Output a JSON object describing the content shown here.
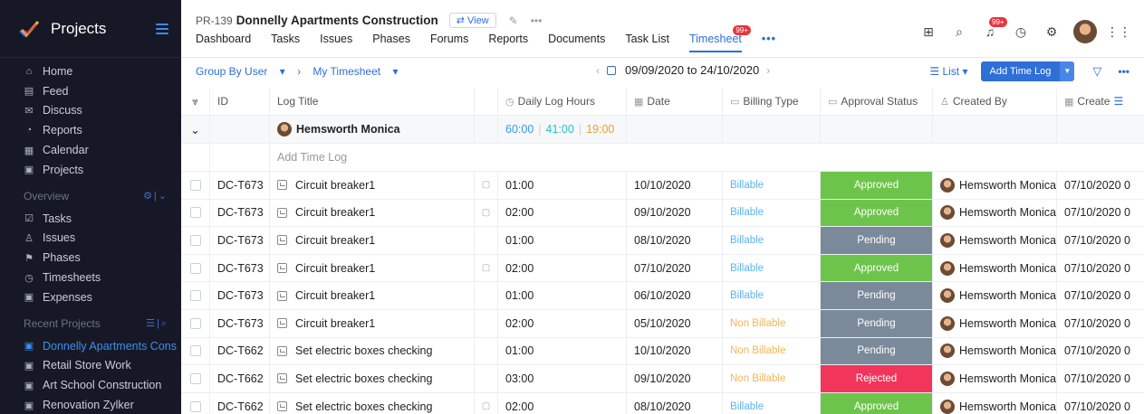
{
  "sidebar": {
    "title": "Projects",
    "nav": [
      {
        "label": "Home",
        "icon": "home-icon",
        "glyph": "⌂"
      },
      {
        "label": "Feed",
        "icon": "feed-icon",
        "glyph": "▤"
      },
      {
        "label": "Discuss",
        "icon": "discuss-icon",
        "glyph": "✉"
      },
      {
        "label": "Reports",
        "icon": "reports-icon",
        "glyph": "◔"
      },
      {
        "label": "Calendar",
        "icon": "calendar-icon",
        "glyph": "▦"
      },
      {
        "label": "Projects",
        "icon": "projects-icon",
        "glyph": "▣"
      }
    ],
    "overview_label": "Overview",
    "overview": [
      {
        "label": "Tasks",
        "icon": "tasks-icon",
        "glyph": "☑"
      },
      {
        "label": "Issues",
        "icon": "issues-icon",
        "glyph": "♙"
      },
      {
        "label": "Phases",
        "icon": "phases-icon",
        "glyph": "⚑"
      },
      {
        "label": "Timesheets",
        "icon": "timesheets-icon",
        "glyph": "◷"
      },
      {
        "label": "Expenses",
        "icon": "expenses-icon",
        "glyph": "▣"
      }
    ],
    "recent_label": "Recent Projects",
    "recent": [
      {
        "label": "Donnelly Apartments Cons",
        "active": true
      },
      {
        "label": "Retail Store Work",
        "active": false
      },
      {
        "label": "Art School Construction",
        "active": false
      },
      {
        "label": "Renovation Zylker",
        "active": false
      }
    ]
  },
  "header": {
    "project_code": "PR-139",
    "project_name": "Donnelly Apartments Construction",
    "view_label": "View",
    "tabs": [
      {
        "label": "Dashboard",
        "active": false
      },
      {
        "label": "Tasks",
        "active": false
      },
      {
        "label": "Issues",
        "active": false
      },
      {
        "label": "Phases",
        "active": false
      },
      {
        "label": "Forums",
        "active": false
      },
      {
        "label": "Reports",
        "active": false
      },
      {
        "label": "Documents",
        "active": false
      },
      {
        "label": "Task List",
        "active": false
      },
      {
        "label": "Timesheet",
        "active": true,
        "badge": "99+"
      }
    ],
    "notification_badge": "99+"
  },
  "toolbar": {
    "group_by": "Group By User",
    "view_name": "My Timesheet",
    "date_range": "09/09/2020 to 24/10/2020",
    "list_label": "List",
    "add_button": "Add Time Log"
  },
  "grid": {
    "columns": {
      "id": "ID",
      "title": "Log Title",
      "hours": "Daily Log Hours",
      "date": "Date",
      "billing": "Billing Type",
      "approval": "Approval Status",
      "created_by": "Created By",
      "created": "Create"
    },
    "group": {
      "name": "Hemsworth Monica",
      "total": "60:00",
      "billable": "41:00",
      "non_billable": "19:00"
    },
    "add_row_label": "Add Time Log",
    "rows": [
      {
        "id": "DC-T673",
        "title": "Circuit breaker1",
        "note": true,
        "hours": "01:00",
        "date": "10/10/2020",
        "billing": "Billable",
        "status": "Approved",
        "by": "Hemsworth Monica",
        "created": "07/10/2020 0"
      },
      {
        "id": "DC-T673",
        "title": "Circuit breaker1",
        "note": true,
        "hours": "02:00",
        "date": "09/10/2020",
        "billing": "Billable",
        "status": "Approved",
        "by": "Hemsworth Monica",
        "created": "07/10/2020 0"
      },
      {
        "id": "DC-T673",
        "title": "Circuit breaker1",
        "note": false,
        "hours": "01:00",
        "date": "08/10/2020",
        "billing": "Billable",
        "status": "Pending",
        "by": "Hemsworth Monica",
        "created": "07/10/2020 0"
      },
      {
        "id": "DC-T673",
        "title": "Circuit breaker1",
        "note": true,
        "hours": "02:00",
        "date": "07/10/2020",
        "billing": "Billable",
        "status": "Approved",
        "by": "Hemsworth Monica",
        "created": "07/10/2020 0"
      },
      {
        "id": "DC-T673",
        "title": "Circuit breaker1",
        "note": false,
        "hours": "01:00",
        "date": "06/10/2020",
        "billing": "Billable",
        "status": "Pending",
        "by": "Hemsworth Monica",
        "created": "07/10/2020 0"
      },
      {
        "id": "DC-T673",
        "title": "Circuit breaker1",
        "note": false,
        "hours": "02:00",
        "date": "05/10/2020",
        "billing": "Non Billable",
        "status": "Pending",
        "by": "Hemsworth Monica",
        "created": "07/10/2020 0"
      },
      {
        "id": "DC-T662",
        "title": "Set electric boxes checking",
        "note": false,
        "hours": "01:00",
        "date": "10/10/2020",
        "billing": "Non Billable",
        "status": "Pending",
        "by": "Hemsworth Monica",
        "created": "07/10/2020 0"
      },
      {
        "id": "DC-T662",
        "title": "Set electric boxes checking",
        "note": false,
        "hours": "03:00",
        "date": "09/10/2020",
        "billing": "Non Billable",
        "status": "Rejected",
        "by": "Hemsworth Monica",
        "created": "07/10/2020 0"
      },
      {
        "id": "DC-T662",
        "title": "Set electric boxes checking",
        "note": true,
        "hours": "02:00",
        "date": "08/10/2020",
        "billing": "Billable",
        "status": "Approved",
        "by": "Hemsworth Monica",
        "created": "07/10/2020 0"
      }
    ]
  },
  "colors": {
    "sidebar_bg": "#161925",
    "accent": "#2f6fd8",
    "approved": "#6dc44a",
    "pending": "#7b8a9a",
    "rejected": "#f2355b"
  }
}
